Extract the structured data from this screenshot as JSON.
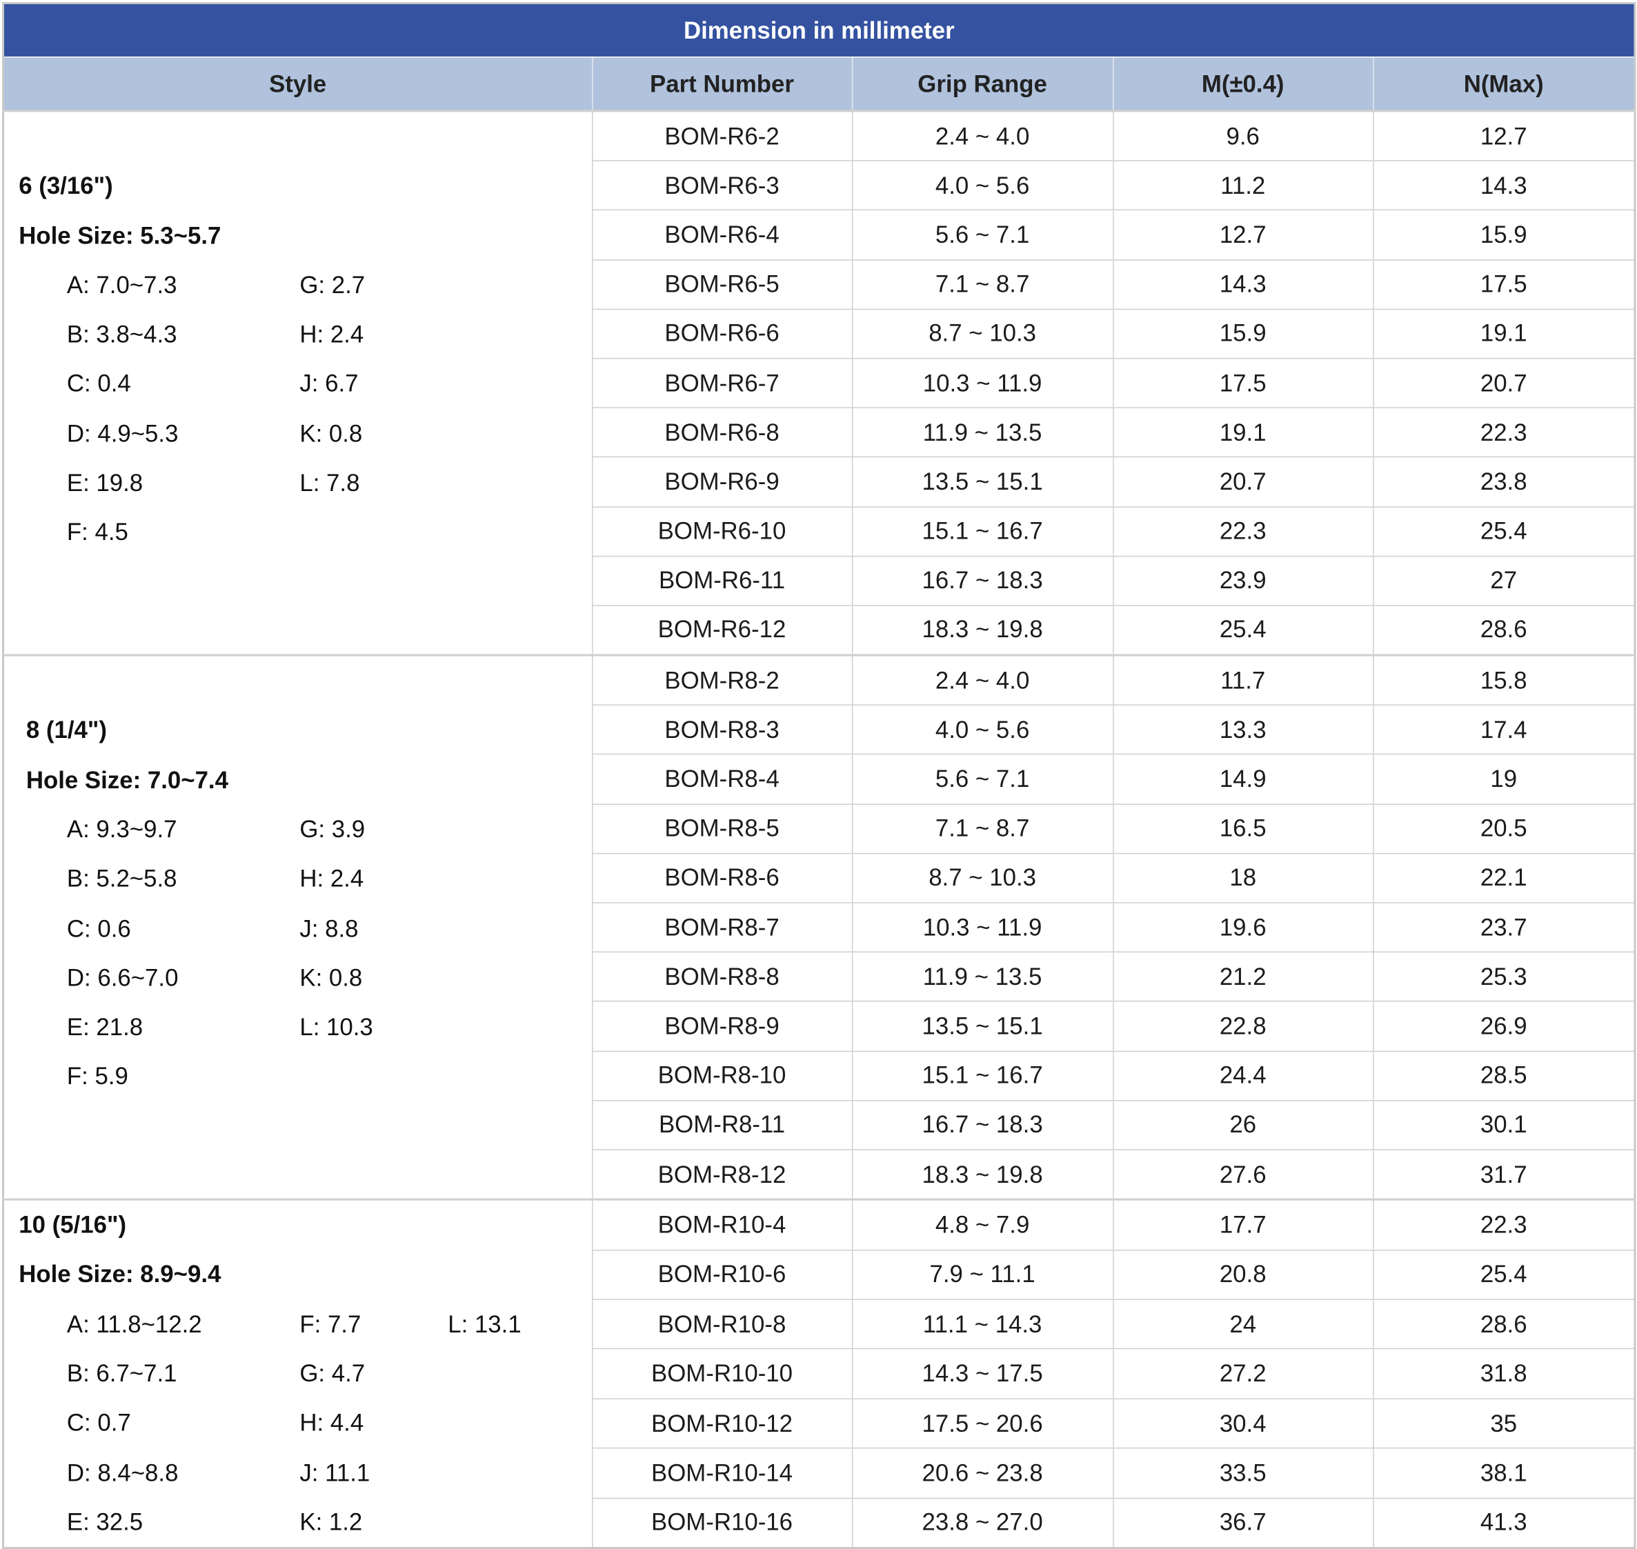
{
  "title": "Dimension in millimeter",
  "headers": {
    "style": "Style",
    "part_number": "Part Number",
    "grip_range": "Grip Range",
    "m": "M(±0.4)",
    "n": "N(Max)"
  },
  "groups": [
    {
      "style_name": "6 (3/16\")",
      "hole_size": "Hole Size: 5.3~5.7",
      "specs": [
        [
          "A: 7.0~7.3",
          "G: 2.7",
          ""
        ],
        [
          "B: 3.8~4.3",
          "H: 2.4",
          ""
        ],
        [
          "C: 0.4",
          "J: 6.7",
          ""
        ],
        [
          "D: 4.9~5.3",
          "K: 0.8",
          ""
        ],
        [
          "E: 19.8",
          "L: 7.8",
          ""
        ],
        [
          "F: 4.5",
          "",
          ""
        ]
      ],
      "rows": [
        [
          "BOM-R6-2",
          "2.4 ~ 4.0",
          "9.6",
          "12.7"
        ],
        [
          "BOM-R6-3",
          "4.0 ~ 5.6",
          "11.2",
          "14.3"
        ],
        [
          "BOM-R6-4",
          "5.6 ~ 7.1",
          "12.7",
          "15.9"
        ],
        [
          "BOM-R6-5",
          "7.1 ~ 8.7",
          "14.3",
          "17.5"
        ],
        [
          "BOM-R6-6",
          "8.7 ~ 10.3",
          "15.9",
          "19.1"
        ],
        [
          "BOM-R6-7",
          "10.3 ~ 11.9",
          "17.5",
          "20.7"
        ],
        [
          "BOM-R6-8",
          "11.9 ~ 13.5",
          "19.1",
          "22.3"
        ],
        [
          "BOM-R6-9",
          "13.5 ~ 15.1",
          "20.7",
          "23.8"
        ],
        [
          "BOM-R6-10",
          "15.1 ~ 16.7",
          "22.3",
          "25.4"
        ],
        [
          "BOM-R6-11",
          "16.7 ~ 18.3",
          "23.9",
          "27"
        ],
        [
          "BOM-R6-12",
          "18.3 ~ 19.8",
          "25.4",
          "28.6"
        ]
      ]
    },
    {
      "style_name": "8 (1/4\")",
      "hole_size": "Hole Size: 7.0~7.4",
      "specs": [
        [
          "A: 9.3~9.7",
          "G: 3.9",
          ""
        ],
        [
          "B: 5.2~5.8",
          "H: 2.4",
          ""
        ],
        [
          "C: 0.6",
          "J: 8.8",
          ""
        ],
        [
          "D: 6.6~7.0",
          "K: 0.8",
          ""
        ],
        [
          "E: 21.8",
          "L: 10.3",
          ""
        ],
        [
          "F: 5.9",
          "",
          ""
        ]
      ],
      "rows": [
        [
          "BOM-R8-2",
          "2.4 ~ 4.0",
          "11.7",
          "15.8"
        ],
        [
          "BOM-R8-3",
          "4.0 ~ 5.6",
          "13.3",
          "17.4"
        ],
        [
          "BOM-R8-4",
          "5.6 ~ 7.1",
          "14.9",
          "19"
        ],
        [
          "BOM-R8-5",
          "7.1 ~ 8.7",
          "16.5",
          "20.5"
        ],
        [
          "BOM-R8-6",
          "8.7 ~ 10.3",
          "18",
          "22.1"
        ],
        [
          "BOM-R8-7",
          "10.3 ~ 11.9",
          "19.6",
          "23.7"
        ],
        [
          "BOM-R8-8",
          "11.9 ~ 13.5",
          "21.2",
          "25.3"
        ],
        [
          "BOM-R8-9",
          "13.5 ~ 15.1",
          "22.8",
          "26.9"
        ],
        [
          "BOM-R8-10",
          "15.1 ~ 16.7",
          "24.4",
          "28.5"
        ],
        [
          "BOM-R8-11",
          "16.7 ~ 18.3",
          "26",
          "30.1"
        ],
        [
          "BOM-R8-12",
          "18.3 ~ 19.8",
          "27.6",
          "31.7"
        ]
      ]
    },
    {
      "style_name": "10 (5/16\")",
      "hole_size": "Hole Size: 8.9~9.4",
      "specs": [
        [
          "A: 11.8~12.2",
          "F: 7.7",
          "L: 13.1"
        ],
        [
          "B: 6.7~7.1",
          "G: 4.7",
          ""
        ],
        [
          "C: 0.7",
          "H: 4.4",
          ""
        ],
        [
          "D: 8.4~8.8",
          "J: 11.1",
          ""
        ],
        [
          "E: 32.5",
          "K: 1.2",
          ""
        ]
      ],
      "rows": [
        [
          "BOM-R10-4",
          "4.8 ~ 7.9",
          "17.7",
          "22.3"
        ],
        [
          "BOM-R10-6",
          "7.9 ~ 11.1",
          "20.8",
          "25.4"
        ],
        [
          "BOM-R10-8",
          "11.1 ~ 14.3",
          "24",
          "28.6"
        ],
        [
          "BOM-R10-10",
          "14.3 ~ 17.5",
          "27.2",
          "31.8"
        ],
        [
          "BOM-R10-12",
          "17.5 ~ 20.6",
          "30.4",
          "35"
        ],
        [
          "BOM-R10-14",
          "20.6 ~ 23.8",
          "33.5",
          "38.1"
        ],
        [
          "BOM-R10-16",
          "23.8 ~ 27.0",
          "36.7",
          "41.3"
        ]
      ]
    }
  ]
}
